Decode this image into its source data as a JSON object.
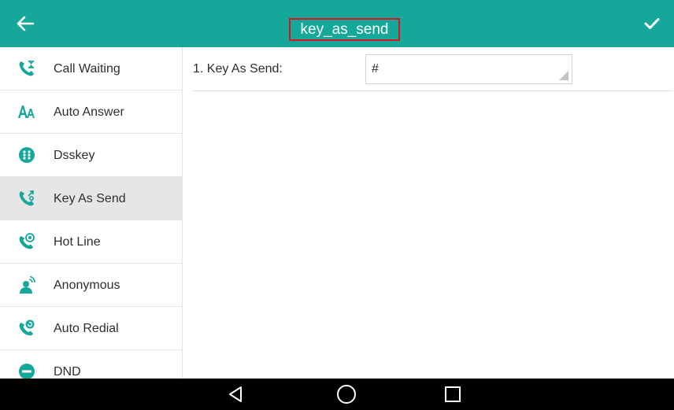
{
  "header": {
    "title": "key_as_send",
    "back_icon": "back-arrow-icon",
    "confirm_icon": "checkmark-icon",
    "highlight_color": "#d9141d",
    "bar_color": "#14a79a"
  },
  "sidebar": {
    "items": [
      {
        "label": "Call Waiting",
        "icon": "call-waiting-icon"
      },
      {
        "label": "Auto Answer",
        "icon": "auto-answer-icon"
      },
      {
        "label": "Dsskey",
        "icon": "dsskey-icon"
      },
      {
        "label": "Key As Send",
        "icon": "key-as-send-icon",
        "selected": true
      },
      {
        "label": "Hot Line",
        "icon": "hot-line-icon"
      },
      {
        "label": "Anonymous",
        "icon": "anonymous-icon"
      },
      {
        "label": "Auto Redial",
        "icon": "auto-redial-icon"
      },
      {
        "label": "DND",
        "icon": "dnd-icon"
      }
    ]
  },
  "main": {
    "settings": [
      {
        "label": "1. Key As Send:",
        "value": "#"
      }
    ]
  },
  "navbar": {
    "back_icon": "nav-back-icon",
    "home_icon": "nav-home-icon",
    "recents_icon": "nav-recents-icon"
  }
}
